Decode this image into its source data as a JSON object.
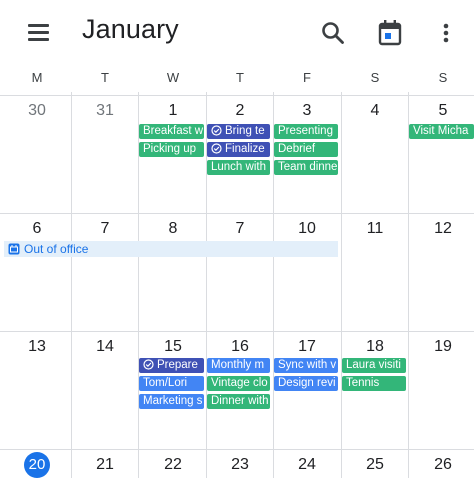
{
  "header": {
    "title": "January",
    "icons": {
      "menu": "menu-icon",
      "search": "search-icon",
      "today": "calendar-today-icon",
      "more": "more-vert-icon"
    }
  },
  "weekdays": [
    "M",
    "T",
    "W",
    "T",
    "F",
    "S",
    "S"
  ],
  "weeks": [
    {
      "days": [
        "30",
        "31",
        "1",
        "2",
        "3",
        "4",
        "5"
      ]
    },
    {
      "days": [
        "6",
        "7",
        "8",
        "7",
        "10",
        "11",
        "12"
      ]
    },
    {
      "days": [
        "13",
        "14",
        "15",
        "16",
        "17",
        "18",
        "19"
      ]
    },
    {
      "days": [
        "20",
        "21",
        "22",
        "23",
        "24",
        "25",
        "26"
      ]
    }
  ],
  "events": {
    "breakfast": "Breakfast w",
    "picking_up": "Picking up",
    "bring": "Bring te",
    "finalize": "Finalize",
    "lunch": "Lunch with",
    "presenting": "Presenting",
    "debrief": "Debrief",
    "team_dinner": "Team dinne",
    "visit": "Visit Micha",
    "out_of_office": "Out of office",
    "prepare": "Prepare",
    "tom_lori": "Tom/Lori",
    "marketing": "Marketing s",
    "monthly": "Monthly m",
    "vintage": "Vintage clo",
    "dinner_with": "Dinner with",
    "sync": "Sync with v",
    "design": "Design revi",
    "laura": "Laura visiti",
    "tennis": "Tennis"
  },
  "colors": {
    "green": "#33b679",
    "indigo": "#3f51b5",
    "light_blue": "#4285f4",
    "today_circle": "#1a73e8",
    "ooo_bg": "#e3effa"
  }
}
